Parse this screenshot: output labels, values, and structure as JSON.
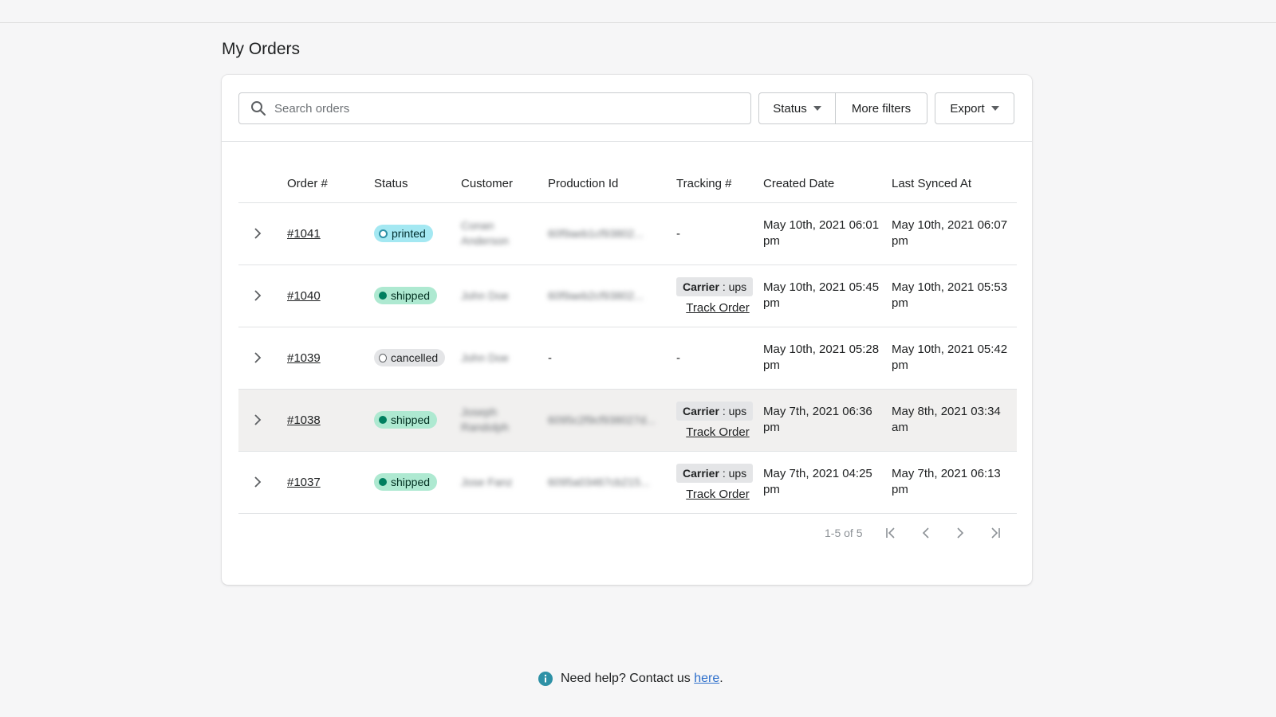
{
  "page": {
    "title": "My Orders"
  },
  "filters": {
    "search_placeholder": "Search orders",
    "status_label": "Status",
    "more_filters_label": "More filters",
    "export_label": "Export"
  },
  "table": {
    "headers": [
      "Order #",
      "Status",
      "Customer",
      "Production Id",
      "Tracking #",
      "Created Date",
      "Last Synced At"
    ],
    "rows": [
      {
        "order": "#1041",
        "status": "printed",
        "customer": "Conan Anderson",
        "production_id": "60f9aeb1cf93802...",
        "tracking": "-",
        "carrier_label": "",
        "carrier_value": "",
        "track_label": "",
        "created": "May 10th, 2021 06:01 pm",
        "synced": "May 10th, 2021 06:07 pm"
      },
      {
        "order": "#1040",
        "status": "shipped",
        "customer": "John Doe",
        "production_id": "60f9aeb2cf93802...",
        "tracking": "",
        "carrier_label": "Carrier",
        "carrier_value": ": ups",
        "track_label": "Track Order",
        "created": "May 10th, 2021 05:45 pm",
        "synced": "May 10th, 2021 05:53 pm"
      },
      {
        "order": "#1039",
        "status": "cancelled",
        "customer": "John Doe",
        "production_id": "-",
        "tracking": "-",
        "carrier_label": "",
        "carrier_value": "",
        "track_label": "",
        "created": "May 10th, 2021 05:28 pm",
        "synced": "May 10th, 2021 05:42 pm"
      },
      {
        "order": "#1038",
        "status": "shipped",
        "customer": "Joseph Randolph",
        "production_id": "6095c2f9cf938027d...",
        "tracking": "",
        "carrier_label": "Carrier",
        "carrier_value": ": ups",
        "track_label": "Track Order",
        "created": "May 7th, 2021 06:36 pm",
        "synced": "May 8th, 2021 03:34 am"
      },
      {
        "order": "#1037",
        "status": "shipped",
        "customer": "Jose Fanz",
        "production_id": "6095a03467cb215...",
        "tracking": "",
        "carrier_label": "Carrier",
        "carrier_value": ": ups",
        "track_label": "Track Order",
        "created": "May 7th, 2021 04:25 pm",
        "synced": "May 7th, 2021 06:13 pm"
      }
    ]
  },
  "pagination": {
    "summary": "1-5 of 5"
  },
  "help": {
    "prefix": "Need help? Contact us ",
    "link": "here",
    "suffix": "."
  },
  "colors": {
    "printed": "#a4e8f2",
    "shipped": "#aee9d1",
    "cancelled": "#e4e5e7",
    "link": "#2c6ecb",
    "info": "#2e91a6"
  },
  "icons": {
    "search": "search-icon",
    "row_expand": "chevron-right-icon",
    "help": "info-icon"
  }
}
